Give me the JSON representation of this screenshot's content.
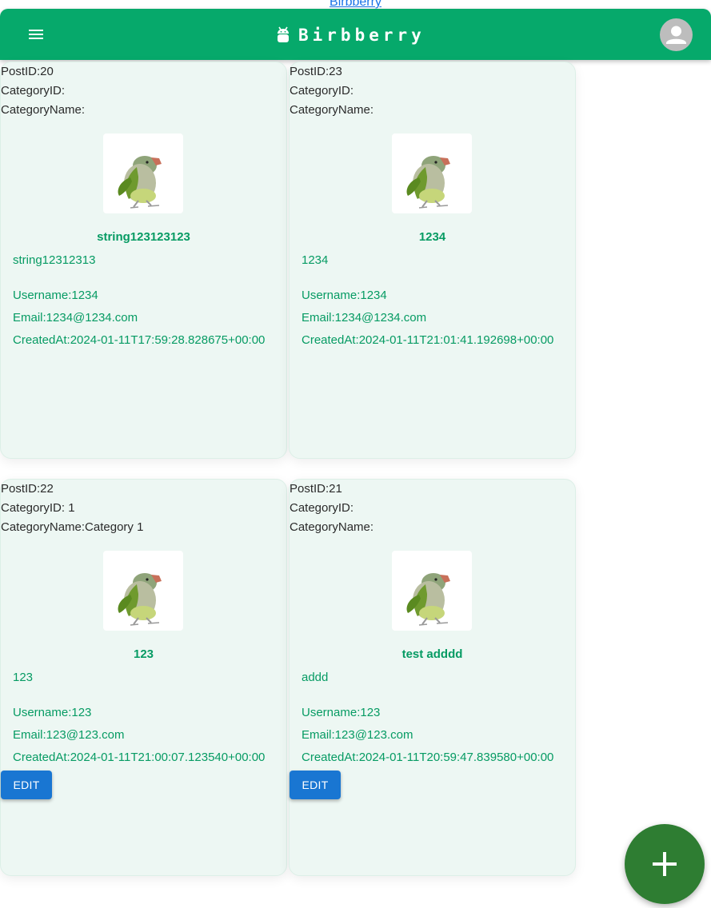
{
  "top_link": "Birbberry",
  "appbar": {
    "brand": "Birbberry",
    "menu_icon": "menu-icon",
    "brand_icon": "android-icon",
    "avatar_icon": "person-icon",
    "color": "#06a96b"
  },
  "labels": {
    "post_id": "PostID:",
    "category_id": "CategoryID:",
    "category_name": "CategoryName:",
    "username": "Username:",
    "email": "Email:",
    "created_at": "CreatedAt:",
    "edit": "EDIT"
  },
  "posts": [
    {
      "post_id": "PostID:20",
      "category_id": "CategoryID:",
      "category_name": "CategoryName:",
      "title": "string123123123",
      "body": "string12312313",
      "username": "Username:1234",
      "email": "Email:1234@1234.com",
      "created_at": "CreatedAt:2024-01-11T17:59:28.828675+00:00",
      "editable": false
    },
    {
      "post_id": "PostID:23",
      "category_id": "CategoryID:",
      "category_name": "CategoryName:",
      "title": "1234",
      "body": "1234",
      "username": "Username:1234",
      "email": "Email:1234@1234.com",
      "created_at": "CreatedAt:2024-01-11T21:01:41.192698+00:00",
      "editable": false
    },
    {
      "post_id": "PostID:22",
      "category_id": "CategoryID: 1",
      "category_name": "CategoryName:Category 1",
      "title": "123",
      "body": "123",
      "username": "Username:123",
      "email": "Email:123@123.com",
      "created_at": "CreatedAt:2024-01-11T21:00:07.123540+00:00",
      "editable": true,
      "edit_label": "EDIT"
    },
    {
      "post_id": "PostID:21",
      "category_id": "CategoryID:",
      "category_name": "CategoryName:",
      "title": "test adddd",
      "body": "addd",
      "username": "Username:123",
      "email": "Email:123@123.com",
      "created_at": "CreatedAt:2024-01-11T20:59:47.839580+00:00",
      "editable": true,
      "edit_label": "EDIT"
    }
  ],
  "fab_icon": "plus-icon",
  "colors": {
    "accent_text": "#069b63",
    "card_bg": "#edf7f3",
    "edit_button": "#1976d2",
    "fab": "#2e7d32"
  }
}
